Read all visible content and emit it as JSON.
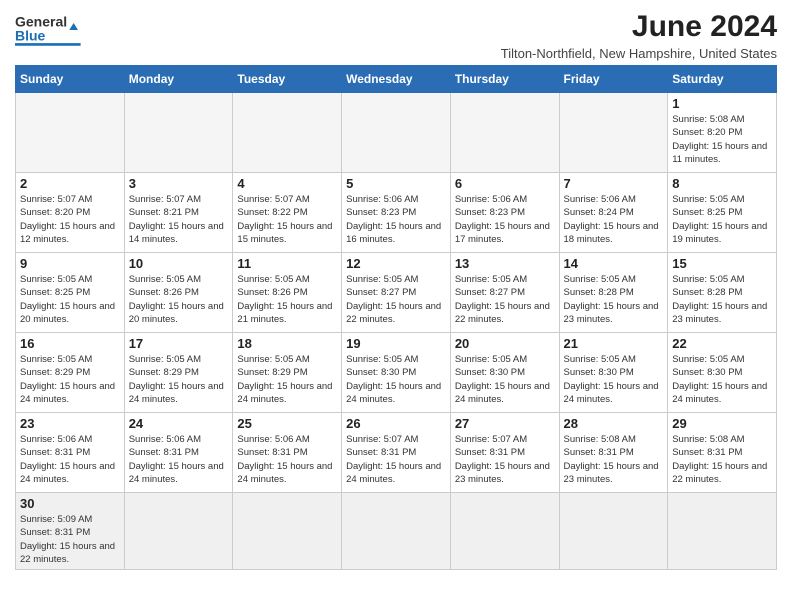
{
  "header": {
    "logo_line1": "General",
    "logo_line2": "Blue",
    "month_title": "June 2024",
    "subtitle": "Tilton-Northfield, New Hampshire, United States"
  },
  "days_of_week": [
    "Sunday",
    "Monday",
    "Tuesday",
    "Wednesday",
    "Thursday",
    "Friday",
    "Saturday"
  ],
  "weeks": [
    [
      {
        "day": "",
        "info": ""
      },
      {
        "day": "",
        "info": ""
      },
      {
        "day": "",
        "info": ""
      },
      {
        "day": "",
        "info": ""
      },
      {
        "day": "",
        "info": ""
      },
      {
        "day": "",
        "info": ""
      },
      {
        "day": "1",
        "info": "Sunrise: 5:08 AM\nSunset: 8:20 PM\nDaylight: 15 hours and 11 minutes."
      }
    ],
    [
      {
        "day": "2",
        "info": "Sunrise: 5:07 AM\nSunset: 8:20 PM\nDaylight: 15 hours and 12 minutes."
      },
      {
        "day": "3",
        "info": "Sunrise: 5:07 AM\nSunset: 8:21 PM\nDaylight: 15 hours and 14 minutes."
      },
      {
        "day": "4",
        "info": "Sunrise: 5:07 AM\nSunset: 8:22 PM\nDaylight: 15 hours and 15 minutes."
      },
      {
        "day": "5",
        "info": "Sunrise: 5:06 AM\nSunset: 8:23 PM\nDaylight: 15 hours and 16 minutes."
      },
      {
        "day": "6",
        "info": "Sunrise: 5:06 AM\nSunset: 8:23 PM\nDaylight: 15 hours and 17 minutes."
      },
      {
        "day": "7",
        "info": "Sunrise: 5:06 AM\nSunset: 8:24 PM\nDaylight: 15 hours and 18 minutes."
      },
      {
        "day": "8",
        "info": "Sunrise: 5:05 AM\nSunset: 8:25 PM\nDaylight: 15 hours and 19 minutes."
      }
    ],
    [
      {
        "day": "9",
        "info": "Sunrise: 5:05 AM\nSunset: 8:25 PM\nDaylight: 15 hours and 20 minutes."
      },
      {
        "day": "10",
        "info": "Sunrise: 5:05 AM\nSunset: 8:26 PM\nDaylight: 15 hours and 20 minutes."
      },
      {
        "day": "11",
        "info": "Sunrise: 5:05 AM\nSunset: 8:26 PM\nDaylight: 15 hours and 21 minutes."
      },
      {
        "day": "12",
        "info": "Sunrise: 5:05 AM\nSunset: 8:27 PM\nDaylight: 15 hours and 22 minutes."
      },
      {
        "day": "13",
        "info": "Sunrise: 5:05 AM\nSunset: 8:27 PM\nDaylight: 15 hours and 22 minutes."
      },
      {
        "day": "14",
        "info": "Sunrise: 5:05 AM\nSunset: 8:28 PM\nDaylight: 15 hours and 23 minutes."
      },
      {
        "day": "15",
        "info": "Sunrise: 5:05 AM\nSunset: 8:28 PM\nDaylight: 15 hours and 23 minutes."
      }
    ],
    [
      {
        "day": "16",
        "info": "Sunrise: 5:05 AM\nSunset: 8:29 PM\nDaylight: 15 hours and 24 minutes."
      },
      {
        "day": "17",
        "info": "Sunrise: 5:05 AM\nSunset: 8:29 PM\nDaylight: 15 hours and 24 minutes."
      },
      {
        "day": "18",
        "info": "Sunrise: 5:05 AM\nSunset: 8:29 PM\nDaylight: 15 hours and 24 minutes."
      },
      {
        "day": "19",
        "info": "Sunrise: 5:05 AM\nSunset: 8:30 PM\nDaylight: 15 hours and 24 minutes."
      },
      {
        "day": "20",
        "info": "Sunrise: 5:05 AM\nSunset: 8:30 PM\nDaylight: 15 hours and 24 minutes."
      },
      {
        "day": "21",
        "info": "Sunrise: 5:05 AM\nSunset: 8:30 PM\nDaylight: 15 hours and 24 minutes."
      },
      {
        "day": "22",
        "info": "Sunrise: 5:05 AM\nSunset: 8:30 PM\nDaylight: 15 hours and 24 minutes."
      }
    ],
    [
      {
        "day": "23",
        "info": "Sunrise: 5:06 AM\nSunset: 8:31 PM\nDaylight: 15 hours and 24 minutes."
      },
      {
        "day": "24",
        "info": "Sunrise: 5:06 AM\nSunset: 8:31 PM\nDaylight: 15 hours and 24 minutes."
      },
      {
        "day": "25",
        "info": "Sunrise: 5:06 AM\nSunset: 8:31 PM\nDaylight: 15 hours and 24 minutes."
      },
      {
        "day": "26",
        "info": "Sunrise: 5:07 AM\nSunset: 8:31 PM\nDaylight: 15 hours and 24 minutes."
      },
      {
        "day": "27",
        "info": "Sunrise: 5:07 AM\nSunset: 8:31 PM\nDaylight: 15 hours and 23 minutes."
      },
      {
        "day": "28",
        "info": "Sunrise: 5:08 AM\nSunset: 8:31 PM\nDaylight: 15 hours and 23 minutes."
      },
      {
        "day": "29",
        "info": "Sunrise: 5:08 AM\nSunset: 8:31 PM\nDaylight: 15 hours and 22 minutes."
      }
    ],
    [
      {
        "day": "30",
        "info": "Sunrise: 5:09 AM\nSunset: 8:31 PM\nDaylight: 15 hours and 22 minutes."
      },
      {
        "day": "",
        "info": ""
      },
      {
        "day": "",
        "info": ""
      },
      {
        "day": "",
        "info": ""
      },
      {
        "day": "",
        "info": ""
      },
      {
        "day": "",
        "info": ""
      },
      {
        "day": "",
        "info": ""
      }
    ]
  ]
}
